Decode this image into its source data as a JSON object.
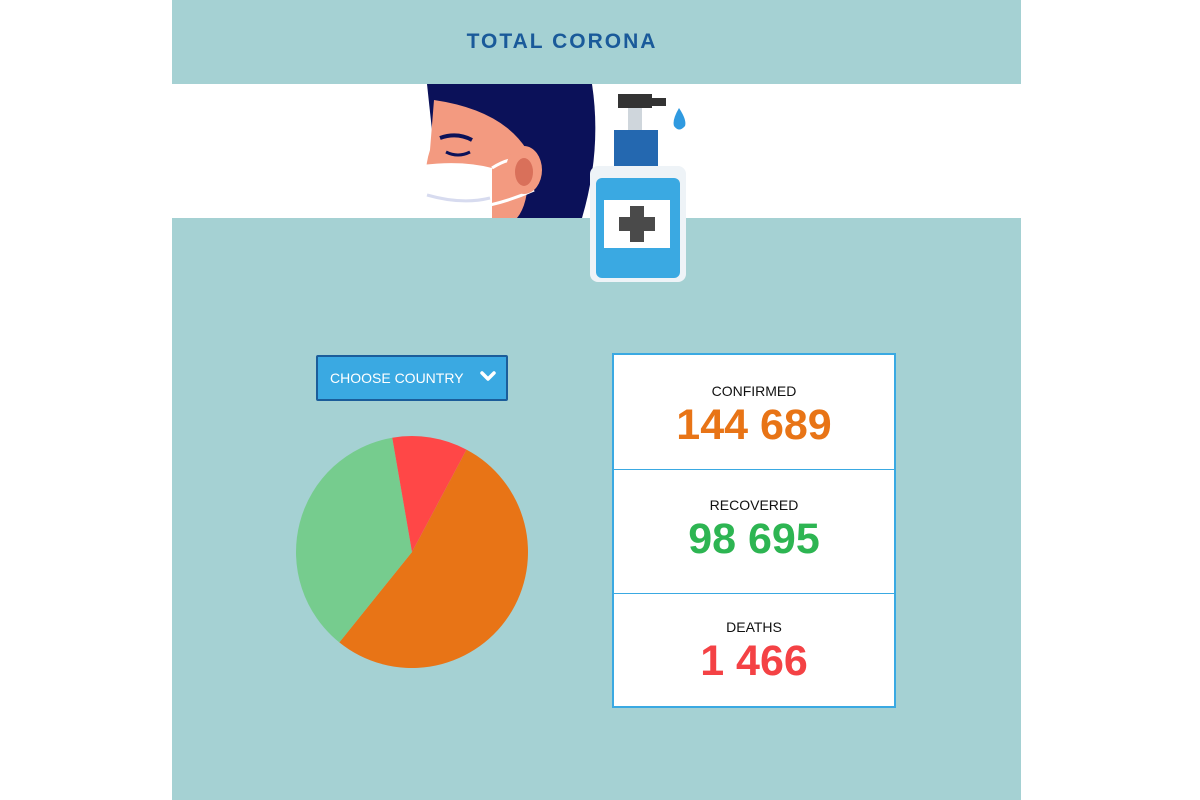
{
  "header": {
    "title": "TOTAL CORONA"
  },
  "dropdown": {
    "label": "CHOOSE COUNTRY"
  },
  "stats": [
    {
      "label": "CONFIRMED",
      "value": "144 689",
      "color": "#e87416"
    },
    {
      "label": "RECOVERED",
      "value": "98 695",
      "color": "#2db552"
    },
    {
      "label": "DEATHS",
      "value": "1 466",
      "color": "#f44245"
    }
  ],
  "colors": {
    "background": "#a5d1d3",
    "title": "#1a5a9a",
    "accent": "#3aa9e2",
    "pie_green": "#76cc8e",
    "pie_orange": "#e87416",
    "pie_red": "#ff4747"
  },
  "chart_data": {
    "type": "pie",
    "labels": [
      "CONFIRMED",
      "RECOVERED",
      "DEATHS"
    ],
    "values": [
      53,
      36.5,
      10.5
    ],
    "colors": [
      "#e87416",
      "#76cc8e",
      "#ff4747"
    ]
  },
  "icons": [
    "masked-person-illustration",
    "hand-sanitizer-illustration",
    "chevron-down-icon"
  ]
}
